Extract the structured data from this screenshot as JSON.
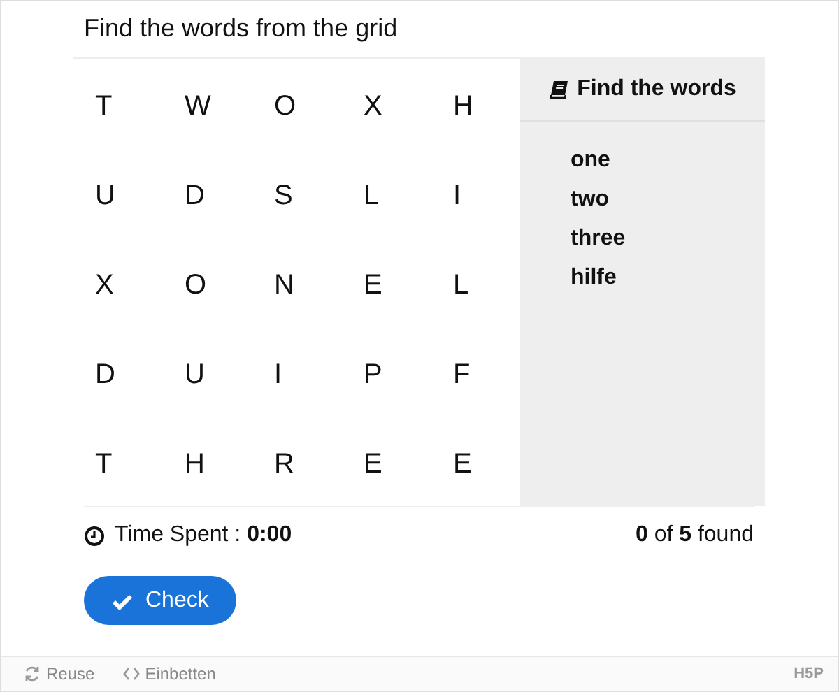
{
  "title": "Find the words from the grid",
  "grid": [
    [
      "T",
      "W",
      "O",
      "X",
      "H"
    ],
    [
      "U",
      "D",
      "S",
      "L",
      "I"
    ],
    [
      "X",
      "O",
      "N",
      "E",
      "L"
    ],
    [
      "D",
      "U",
      "I",
      "P",
      "F"
    ],
    [
      "T",
      "H",
      "R",
      "E",
      "E"
    ]
  ],
  "word_panel": {
    "title": "Find the words",
    "words": [
      "one",
      "two",
      "three",
      "hilfe"
    ]
  },
  "timer": "Time Spent : **0:00**",
  "counter": "**0** of **5** found",
  "check_button": "Check",
  "footer": {
    "actions": [
      {
        "kind": "reuse",
        "label": "Reuse"
      },
      {
        "kind": "embed",
        "label": "Einbetten"
      }
    ],
    "logo": "H5P"
  }
}
